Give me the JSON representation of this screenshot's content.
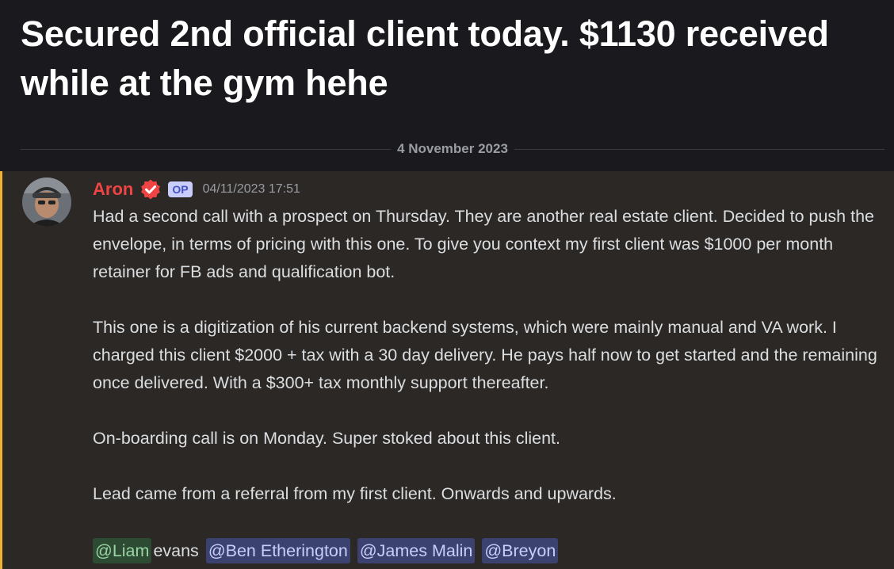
{
  "thread": {
    "title": "Secured 2nd official client today. $1130 received while at the gym hehe",
    "date_divider": "4 November 2023"
  },
  "message": {
    "author": "Aron",
    "author_color": "#ef4444",
    "badge": "OP",
    "timestamp": "04/11/2023 17:51",
    "verified_icon": "verified-check-icon",
    "paragraphs": [
      "Had a second call with a prospect on Thursday. They are another real estate client. Decided to push the envelope, in terms of pricing with this one. To give you context my first client was $1000 per month retainer for FB ads and qualification bot.",
      "This one is a digitization of his current backend systems, which were mainly manual and VA work. I charged this client $2000 + tax with a 30 day delivery. He pays half now to get started and the remaining once delivered. With a $300+ tax monthly support thereafter.",
      "On-boarding call is on Monday. Super stoked about this client.",
      "Lead came from a referral from my first client. Onwards and upwards."
    ],
    "mentions": {
      "first": "@Liam",
      "first_suffix": "evans",
      "others": [
        "@Ben Etherington",
        "@James Malin",
        "@Breyon"
      ]
    }
  },
  "colors": {
    "accent_bar": "#f0b232",
    "mention_bg": "#3c4270",
    "mention_text": "#c9cdfb"
  }
}
